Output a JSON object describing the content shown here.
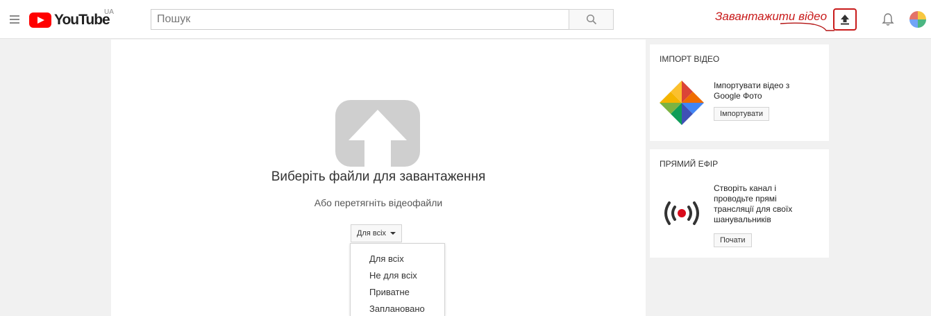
{
  "header": {
    "logo_text": "YouTube",
    "region": "UA",
    "search_placeholder": "Пошук",
    "upload_annotation": "Завантажити відео"
  },
  "icons": {
    "menu": "hamburger-menu-icon",
    "search": "magnifier-icon",
    "upload": "upload-arrow-icon",
    "notifications": "bell-icon",
    "upload_graphic": "cloud-upload-icon",
    "google_photos": "pinwheel-icon",
    "live": "broadcast-icon"
  },
  "colors": {
    "brand_red": "#ff0000",
    "annotation_red": "#c81a1a",
    "upload_graphic_gray": "#cfcfcf",
    "live_red": "#d90b1c"
  },
  "upload": {
    "title": "Виберіть файли для завантаження",
    "subtitle": "Або перетягніть відеофайли",
    "privacy_selected": "Для всіх",
    "privacy_options": [
      "Для всіх",
      "Не для всіх",
      "Приватне",
      "Заплановано"
    ]
  },
  "sidebar": {
    "import": {
      "title": "ІМПОРТ ВІДЕО",
      "text": "Імпортувати відео з Google Фото",
      "button": "Імпортувати"
    },
    "live": {
      "title": "ПРЯМИЙ ЕФІР",
      "text": "Створіть канал і проводьте прямі трансляції для своїх шанувальників",
      "button": "Почати"
    }
  }
}
